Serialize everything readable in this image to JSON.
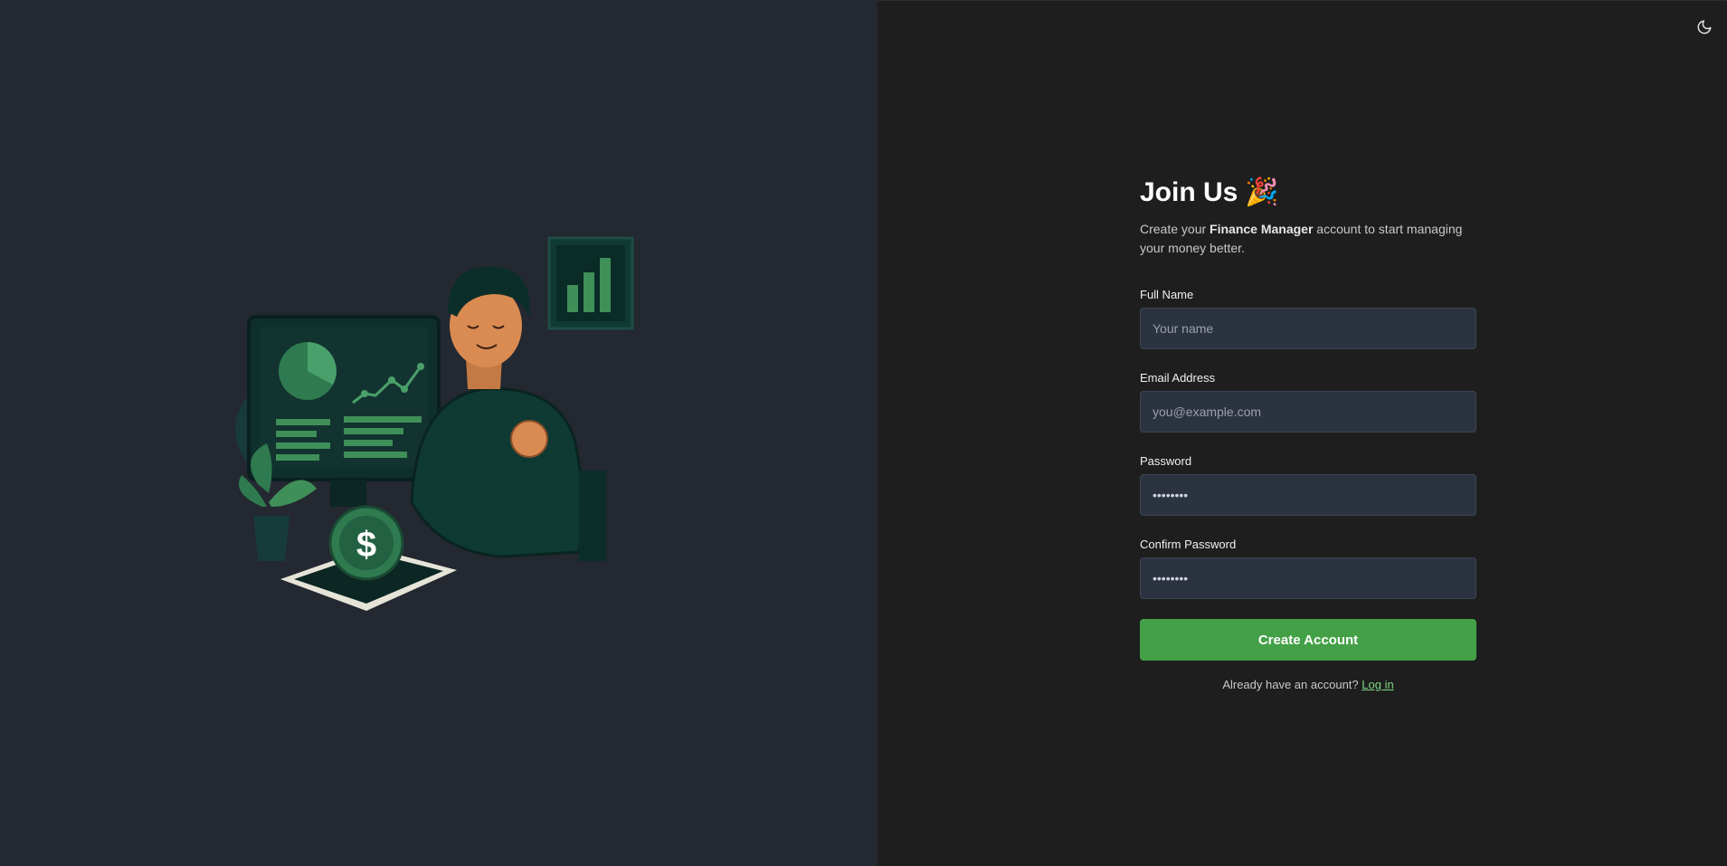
{
  "form": {
    "title": "Join Us",
    "title_emoji": "🎉",
    "subtitle_pre": "Create your ",
    "subtitle_brand": "Finance Manager",
    "subtitle_post": " account to start managing your money better.",
    "fields": [
      {
        "label": "Full Name",
        "placeholder": "Your name",
        "value": ""
      },
      {
        "label": "Email Address",
        "placeholder": "you@example.com",
        "value": ""
      },
      {
        "label": "Password",
        "placeholder": "",
        "value": "••••••••"
      },
      {
        "label": "Confirm Password",
        "placeholder": "",
        "value": "••••••••"
      }
    ],
    "submit_label": "Create Account",
    "login_prompt": "Already have an account?",
    "login_link": "Log in"
  },
  "icons": {
    "theme_toggle": "moon-icon",
    "illustration": "finance-person-illustration",
    "coin": "dollar-coin-icon"
  },
  "colors": {
    "accent": "#43a047",
    "left_bg": "#232831",
    "right_bg": "#1e1e1e",
    "input_bg": "#2c3340"
  }
}
